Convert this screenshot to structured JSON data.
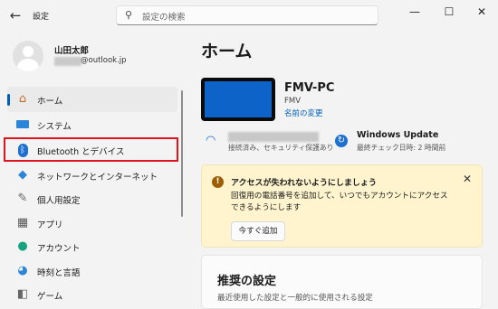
{
  "window": {
    "title": "設定",
    "search_placeholder": "設定の検索",
    "minimize": "—",
    "maximize": "☐",
    "close": "✕"
  },
  "user": {
    "name": "山田太郎",
    "email_domain": "@outlook.jp"
  },
  "sidebar": {
    "items": [
      {
        "label": "ホーム",
        "icon": "home-icon",
        "selected": true
      },
      {
        "label": "システム",
        "icon": "system-icon"
      },
      {
        "label": "Bluetooth とデバイス",
        "icon": "bluetooth-icon"
      },
      {
        "label": "ネットワークとインターネット",
        "icon": "network-icon"
      },
      {
        "label": "個人用設定",
        "icon": "personalization-icon"
      },
      {
        "label": "アプリ",
        "icon": "apps-icon"
      },
      {
        "label": "アカウント",
        "icon": "accounts-icon"
      },
      {
        "label": "時刻と言語",
        "icon": "time-language-icon"
      },
      {
        "label": "ゲーム",
        "icon": "gaming-icon"
      }
    ]
  },
  "main": {
    "title": "ホーム",
    "device": {
      "name": "FMV-PC",
      "model": "FMV",
      "rename_link": "名前の変更"
    },
    "network": {
      "status": "接続済み、セキュリティ保護あり"
    },
    "update": {
      "title": "Windows Update",
      "last_check": "最終チェック日時: 2 時間前"
    },
    "alert": {
      "title": "アクセスが失われないようにしましょう",
      "body": "回復用の電話番号を追加して、いつでもアカウントにアクセスできるようにします",
      "button": "今すぐ追加"
    },
    "recommended": {
      "title": "推奨の設定",
      "subtitle": "最近使用した設定と一般的に使用される設定"
    }
  },
  "colors": {
    "accent": "#005fb8",
    "highlight_box": "#e0131f",
    "alert_bg": "#fff4ce"
  }
}
